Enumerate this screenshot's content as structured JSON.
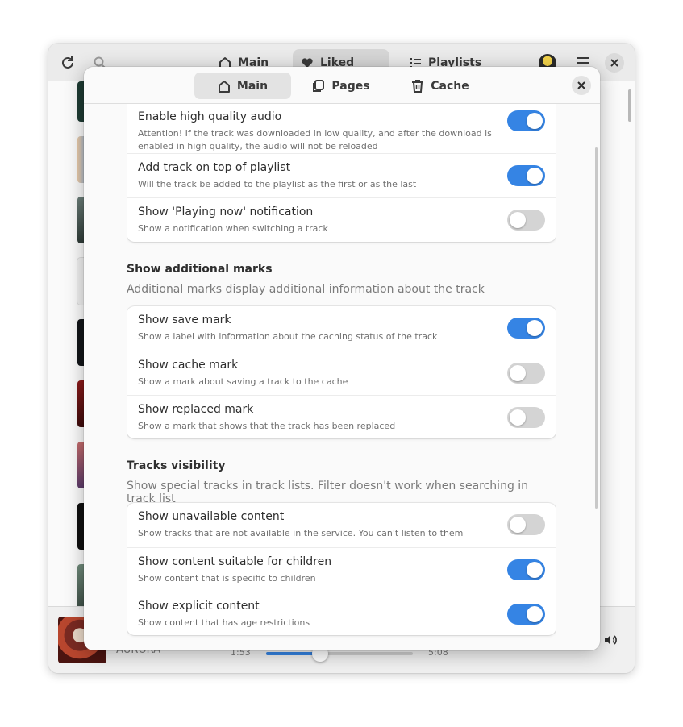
{
  "main_window": {
    "tabs": [
      {
        "label": "Main",
        "icon": "home-icon"
      },
      {
        "label": "Liked",
        "icon": "heart-icon"
      },
      {
        "label": "Playlists",
        "icon": "list-icon"
      }
    ],
    "active_tab": "Liked",
    "player": {
      "artist": "AURORA",
      "elapsed": "1:53",
      "duration": "5:08",
      "progress": 0.37
    }
  },
  "dialog": {
    "tabs": [
      {
        "label": "Main",
        "icon": "home-icon"
      },
      {
        "label": "Pages",
        "icon": "pages-icon"
      },
      {
        "label": "Cache",
        "icon": "trash-icon"
      }
    ],
    "active_tab": "Main",
    "groups": [
      {
        "title": "",
        "description": "",
        "rows": [
          {
            "title": "Enable high quality audio",
            "subtitle": "Attention! If the track was downloaded in low quality, and after the download is enabled in high quality, the audio will not be reloaded",
            "enabled": true
          },
          {
            "title": "Add track on top of playlist",
            "subtitle": "Will the track be added to the playlist as the first or as the last",
            "enabled": true
          },
          {
            "title": "Show 'Playing now' notification",
            "subtitle": "Show a notification when switching a track",
            "enabled": false
          }
        ]
      },
      {
        "title": "Show additional marks",
        "description": "Additional marks display additional information about the track",
        "rows": [
          {
            "title": "Show save mark",
            "subtitle": "Show a label with information about the caching status of the track",
            "enabled": true
          },
          {
            "title": "Show cache mark",
            "subtitle": "Show a mark about saving a track to the cache",
            "enabled": false
          },
          {
            "title": "Show replaced mark",
            "subtitle": "Show a mark that shows that the track has been replaced",
            "enabled": false
          }
        ]
      },
      {
        "title": "Tracks visibility",
        "description": "Show special tracks in track lists. Filter doesn't work when searching in track list",
        "rows": [
          {
            "title": "Show unavailable content",
            "subtitle": "Show tracks that are not available in the service. You can't listen to them",
            "enabled": false
          },
          {
            "title": "Show content suitable for children",
            "subtitle": "Show content that is specific to children",
            "enabled": true
          },
          {
            "title": "Show explicit content",
            "subtitle": "Show content that has age restrictions",
            "enabled": true
          }
        ]
      }
    ]
  },
  "colors": {
    "accent": "#3584e4",
    "toggle_off": "#d4d4d4"
  }
}
